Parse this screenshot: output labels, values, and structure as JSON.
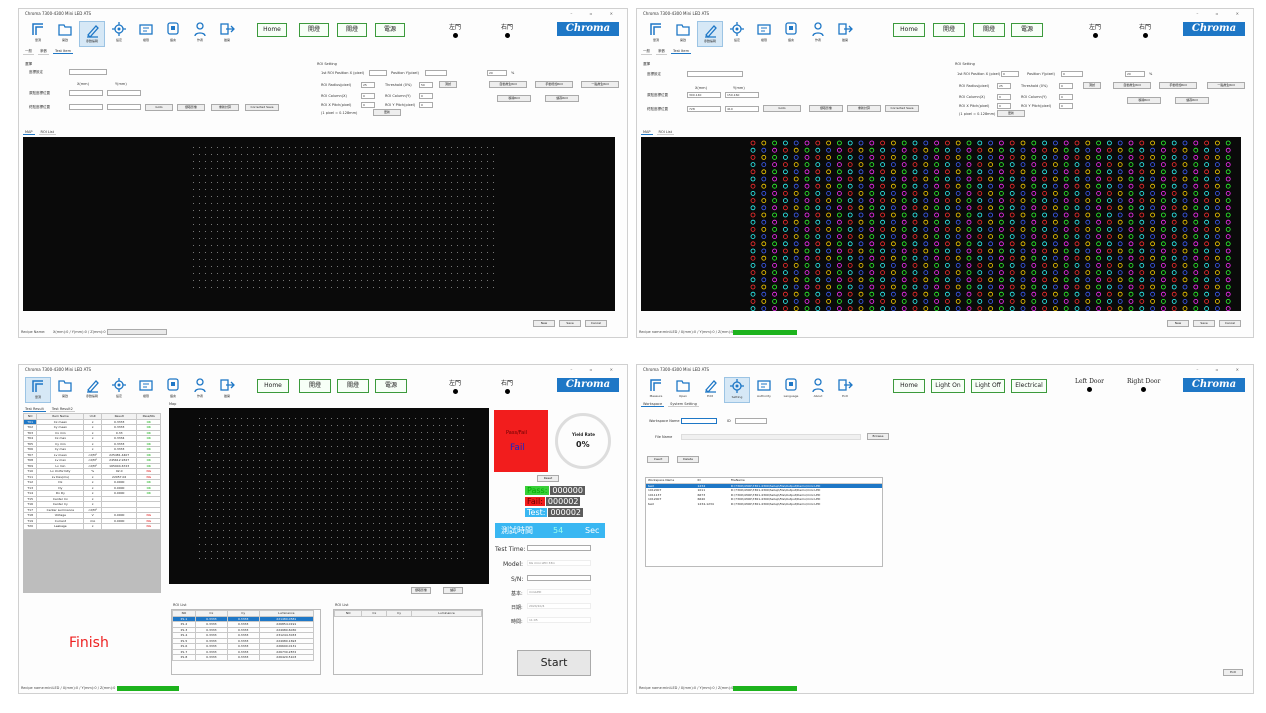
{
  "app": {
    "title": "Chroma 7300-4300 Mini LED ATS",
    "logo": "Chroma",
    "window_controls": "–  ▫  ✕"
  },
  "toolbar_cn": [
    {
      "label": "量測",
      "icon": "measure-icon"
    },
    {
      "label": "開啟",
      "icon": "open-folder-icon"
    },
    {
      "label": "參數編輯",
      "icon": "edit-icon"
    },
    {
      "label": "設定",
      "icon": "settings-icon"
    },
    {
      "label": "權限",
      "icon": "authority-icon"
    },
    {
      "label": "語言",
      "icon": "language-icon"
    },
    {
      "label": "作者",
      "icon": "about-icon"
    },
    {
      "label": "離開",
      "icon": "exit-icon"
    }
  ],
  "toolbar_en": [
    {
      "label": "Measure",
      "icon": "measure-icon"
    },
    {
      "label": "Open",
      "icon": "open-folder-icon"
    },
    {
      "label": "Edit",
      "icon": "edit-icon"
    },
    {
      "label": "Setting",
      "icon": "settings-icon"
    },
    {
      "label": "Authority",
      "icon": "authority-icon"
    },
    {
      "label": "Language",
      "icon": "language-icon"
    },
    {
      "label": "About",
      "icon": "about-icon"
    },
    {
      "label": "Exit",
      "icon": "exit-icon"
    }
  ],
  "buttons_cn": {
    "home": "Home",
    "light_on": "開燈",
    "light_off": "關燈",
    "power": "電源"
  },
  "buttons_en": {
    "home": "Home",
    "light_on": "Light On",
    "light_off": "Light Off",
    "power": "Electrical"
  },
  "doors_cn": {
    "left": "左門",
    "right": "右門"
  },
  "doors_en": {
    "left": "Left Door",
    "right": "Right Door"
  },
  "edit_panel": {
    "tabs": [
      "一般",
      "參數",
      "Test Item"
    ],
    "group_label": "選擇",
    "row1_label": "座標設定",
    "x_label": "X(mm)",
    "y_label": "Y(mm)",
    "row2_label": "原點座標位置",
    "row3_label": "終點座標位置",
    "btn_goto": "Goto",
    "btn_capture": "擷取影像",
    "btn_redraw": "重新計算",
    "btn_corrected": "Corrected Save",
    "roi_group": "ROI Setting",
    "roi_first_x": "1st ROI Position X (pixel)",
    "roi_first_y": "Position Y(pixel)",
    "roi_radius": "ROI Radius(pixel)",
    "roi_threshold": "Threshold (0%)",
    "roi_col": "ROI Column(X)",
    "roi_col_pitch": "ROI Column(Y)",
    "roi_row_pitch_x": "ROI X Pitch(pixel)",
    "roi_row_pitch_y": "ROI Y Pitch(pixel)",
    "roi_note": "(1 pixel = 0.128mm)",
    "btn_update": "更新",
    "btn_test": "測試",
    "btn_auto_roi": "自動產生ROI",
    "btn_manual_roi": "手動增加ROI",
    "btn_one_roi": "一點產生ROI",
    "btn_del_roi": "移除ROI",
    "btn_save_roi": "儲存ROI",
    "percent_unit": "%",
    "percent_val": "20",
    "radius_val": "25",
    "threshold_val": "50",
    "col_val": "0",
    "pitch_val": "0",
    "view_tabs": [
      "MAP",
      "ROI List"
    ],
    "footer_new": "New",
    "footer_save": "Save",
    "footer_cancel": "Cancel",
    "status_left": "Recipe Name:",
    "status_coords": "X(mm):0 / Y(mm):0 / Z(mm):0",
    "status_recipe": "Recipe name:miniLED / X(mm):0 / Y(mm):0 / Z(mm):0",
    "origin_x": "300.140",
    "origin_y": "150.160",
    "end_x": "728",
    "end_y": "410"
  },
  "measure_panel": {
    "result_tabs": [
      "Test Result",
      "Test Result2"
    ],
    "columns": [
      "NO",
      "Item Name",
      "Unit",
      "Result",
      "Pass/NG"
    ],
    "rows": [
      [
        "T01",
        "Cx mean",
        "x",
        "0.3333",
        "OK"
      ],
      [
        "T02",
        "Cy mean",
        "x",
        "0.3333",
        "OK"
      ],
      [
        "T03",
        "Cx min",
        "x",
        "0.33",
        "OK"
      ],
      [
        "T04",
        "Cx max",
        "x",
        "0.3334",
        "OK"
      ],
      [
        "T05",
        "Cy min",
        "x",
        "0.3333",
        "OK"
      ],
      [
        "T06",
        "Cy max",
        "x",
        "0.3333",
        "OK"
      ],
      [
        "T07",
        "Lv mean",
        "cd/M²",
        "225481.4407",
        "OK"
      ],
      [
        "T08",
        "Lv max",
        "cd/M²",
        "245612.9327",
        "OK"
      ],
      [
        "T09",
        "Lv min",
        "cd/M²",
        "165904.6723",
        "OK"
      ],
      [
        "T10",
        "Lv Uniformity",
        "%",
        "92.0",
        "NG"
      ],
      [
        "T11",
        "Lv Dev(ms)",
        "x",
        "22057.02",
        "NG"
      ],
      [
        "T12",
        "Dx",
        "x",
        "0.0000",
        "OK"
      ],
      [
        "T13",
        "Dy",
        "x",
        "0.0000",
        "OK"
      ],
      [
        "T14",
        "Dx Dy",
        "x",
        "0.0000",
        "OK"
      ],
      [
        "T15",
        "Center Cx",
        "x",
        "",
        ""
      ],
      [
        "T16",
        "Center Cy",
        "x",
        "",
        ""
      ],
      [
        "T17",
        "Center Luminance",
        "cd/M²",
        "",
        ""
      ],
      [
        "T18",
        "Voltage",
        "V",
        "0.0000",
        "NG"
      ],
      [
        "T19",
        "Current",
        "mA",
        "0.0000",
        "NG"
      ],
      [
        "T20",
        "Leakage",
        "x",
        "",
        "NG"
      ]
    ],
    "finish": "Finish",
    "map_title": "Map",
    "btn_clear": "擷取影像",
    "btn_save": "儲存",
    "roi_list_title": "ROI List",
    "roi_columns": [
      "NO",
      "Cx",
      "Cy",
      "Luminance"
    ],
    "roi_rows": [
      [
        "P1-1",
        "0.3333",
        "0.3333",
        "221480.0581"
      ],
      [
        "P1-2",
        "0.3333",
        "0.3333",
        "226854.0191"
      ],
      [
        "P1-3",
        "0.3333",
        "0.3333",
        "224980.6030"
      ],
      [
        "P1-4",
        "0.3333",
        "0.3333",
        "231244.3033"
      ],
      [
        "P1-5",
        "0.3333",
        "0.3333",
        "224980.1693"
      ],
      [
        "P1-6",
        "0.3333",
        "0.3333",
        "226690.0131"
      ],
      [
        "P1-7",
        "0.3333",
        "0.3333",
        "226730.2872"
      ],
      [
        "P1-8",
        "0.3333",
        "0.3333",
        "226420.5103"
      ]
    ],
    "roi2_title": "ROI List",
    "roi2_columns": [
      "NO",
      "Cx",
      "Cy",
      "Luminance"
    ],
    "pass_fail_label": "Pass/Fail",
    "pass_fail_value": "Fail",
    "yield_label": "Yield Rate",
    "yield_value": "0%",
    "reset": "Reset",
    "pass_label": "Pass:",
    "pass_value": "000000",
    "fail_label": "Fail:",
    "fail_value": "000002",
    "test_label": "Test:",
    "test_value": "000002",
    "timer_label": "測試時間",
    "timer_value": "54",
    "timer_unit": "Sec",
    "test_time_label": "Test Time:",
    "model_label": "Model:",
    "model_value": "6G mini LED 33in",
    "sn_label": "S/N:",
    "info1_label": "基本:",
    "info1_value": "miniLED",
    "info2_label": "日期:",
    "info2_value": "2024/10/4",
    "info3_label": "時間:",
    "info3_value": "11:05",
    "start": "Start",
    "status": "Recipe name:miniLED / X(mm):0 / Y(mm):0 / Z(mm):0"
  },
  "setting_panel": {
    "tabs": [
      "Workspace",
      "System Setting"
    ],
    "ws_name_label": "Workspace Name",
    "id_label": "ID",
    "file_name_label": "File Name",
    "browse": "Browse",
    "insert": "Insert",
    "delete": "Delete",
    "columns": [
      "Workspace Name",
      "ID",
      "FileName"
    ],
    "rows": [
      [
        "test",
        "1234",
        "D:\\7300\\4300\\7361-4300\\Setup\\File\\Output\\Demo\\mini LED"
      ],
      [
        "1012007",
        "1011",
        "D:\\7300\\4300\\7361-4300\\Setup\\File\\Output\\Demo\\mini LED"
      ],
      [
        "1011137",
        "6673",
        "D:\\7300\\4300\\7361-4300\\Setup\\File\\Output\\Demo\\mini LED"
      ],
      [
        "1012007",
        "6640",
        "D:\\7300\\4300\\7361-4300\\Setup\\File\\Output\\Demo\\mini LED"
      ],
      [
        "test",
        "1234-1234",
        "D:\\7300\\4300\\7361-4300\\Setup\\File\\Output\\Demo\\mini LED"
      ]
    ],
    "exit": "Exit",
    "status": "Recipe name:miniLED / X(mm):0 / Y(mm):0 / Z(mm):0"
  },
  "colors": {
    "accent": "#1e77c6",
    "green_btn": "#3c9a3c",
    "fail_red": "#f21d1d",
    "timer_blue": "#39b7f2",
    "progress_green": "#1db31d"
  }
}
